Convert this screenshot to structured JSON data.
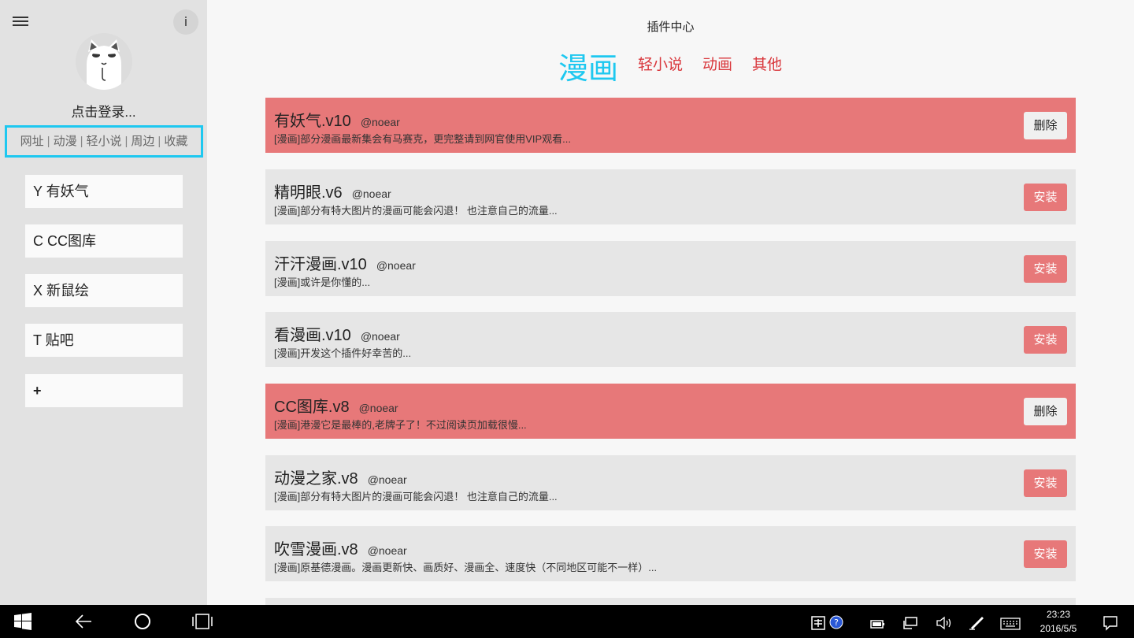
{
  "sidebar": {
    "login_text": "点击登录...",
    "info_label": "i",
    "category_links": [
      "网址",
      "动漫",
      "轻小说",
      "周边",
      "收藏"
    ],
    "sites": [
      {
        "label": "Y 有妖气"
      },
      {
        "label": "C CC图库"
      },
      {
        "label": "X 新鼠绘"
      },
      {
        "label": "T 贴吧"
      },
      {
        "label": "+"
      }
    ]
  },
  "main": {
    "title": "插件中心",
    "tabs": [
      {
        "label": "漫画",
        "active": true
      },
      {
        "label": "轻小说",
        "active": false
      },
      {
        "label": "动画",
        "active": false
      },
      {
        "label": "其他",
        "active": false
      }
    ],
    "plugins": [
      {
        "name": "有妖气.v10",
        "author": "@noear",
        "desc": "[漫画]部分漫画最新集会有马赛克，更完整请到网官使用VIP观看...",
        "button": "删除",
        "installed": true
      },
      {
        "name": "精明眼.v6",
        "author": "@noear",
        "desc": "[漫画]部分有特大图片的漫画可能会闪退！ 也注意自己的流量...",
        "button": "安装",
        "installed": false
      },
      {
        "name": "汗汗漫画.v10",
        "author": "@noear",
        "desc": "[漫画]或许是你懂的...",
        "button": "安装",
        "installed": false
      },
      {
        "name": "看漫画.v10",
        "author": "@noear",
        "desc": "[漫画]开发这个插件好幸苦的...",
        "button": "安装",
        "installed": false
      },
      {
        "name": "CC图库.v8",
        "author": "@noear",
        "desc": "[漫画]港漫它是最棒的,老牌子了！不过阅读页加载很慢...",
        "button": "删除",
        "installed": true
      },
      {
        "name": "动漫之家.v8",
        "author": "@noear",
        "desc": "[漫画]部分有特大图片的漫画可能会闪退！ 也注意自己的流量...",
        "button": "安装",
        "installed": false
      },
      {
        "name": "吹雪漫画.v8",
        "author": "@noear",
        "desc": "[漫画]原基德漫画。漫画更新快、画质好、漫画全、速度快（不同地区可能不一样）...",
        "button": "安装",
        "installed": false
      }
    ]
  },
  "taskbar": {
    "time": "23:23",
    "date": "2016/5/5",
    "icons": [
      "windows-start-icon",
      "back-icon",
      "search-circle-icon",
      "task-view-icon",
      "ime-icon",
      "help-icon",
      "battery-icon",
      "network-icon",
      "volume-icon",
      "pen-icon",
      "keyboard-icon",
      "notification-icon"
    ]
  },
  "colors": {
    "accent": "#1ec8f0",
    "tab_red": "#d9373c",
    "installed_bg": "#e77879",
    "card_bg": "#e6e6e6",
    "sidebar_bg": "#e2e2e2"
  }
}
